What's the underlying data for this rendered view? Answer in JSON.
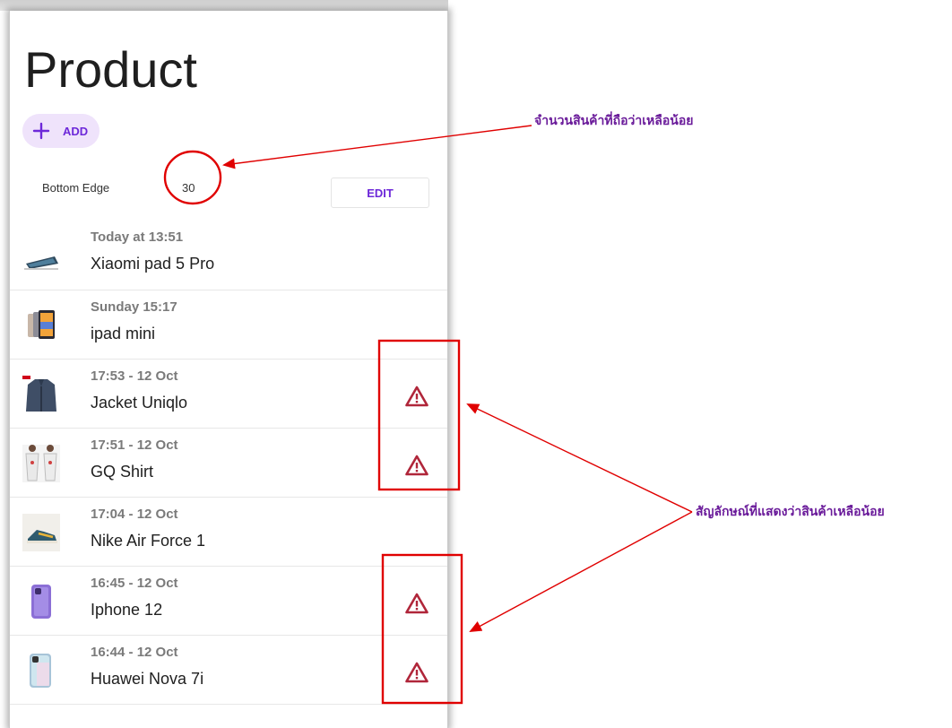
{
  "page": {
    "title": "Product"
  },
  "toolbar": {
    "add_label": "ADD",
    "edit_label": "EDIT"
  },
  "threshold": {
    "label": "Bottom Edge",
    "value": "30"
  },
  "products": [
    {
      "time": "Today at 13:51",
      "name": "Xiaomi pad 5 Pro",
      "low_stock": false,
      "thumb": "tablet-thumb"
    },
    {
      "time": "Sunday 15:17",
      "name": "ipad mini",
      "low_stock": false,
      "thumb": "ipad-thumb"
    },
    {
      "time": "17:53 - 12 Oct",
      "name": "Jacket Uniqlo",
      "low_stock": true,
      "thumb": "jacket-thumb"
    },
    {
      "time": "17:51 - 12 Oct",
      "name": "GQ Shirt",
      "low_stock": true,
      "thumb": "shirt-thumb"
    },
    {
      "time": "17:04 - 12 Oct",
      "name": "Nike Air Force 1",
      "low_stock": false,
      "thumb": "sneaker-thumb"
    },
    {
      "time": "16:45 - 12 Oct",
      "name": "Iphone 12",
      "low_stock": true,
      "thumb": "iphone-thumb"
    },
    {
      "time": "16:44 - 12 Oct",
      "name": "Huawei Nova 7i",
      "low_stock": true,
      "thumb": "huawei-thumb"
    }
  ],
  "annotations": {
    "threshold_note": "จำนวนสินค้าที่ถือว่าเหลือน้อย",
    "warning_note": "สัญลักษณ์ที่แสดงว่าสินค้าเหลือน้อย"
  },
  "colors": {
    "accent": "#6d28d9",
    "warning": "#b0263a",
    "annotation": "#e00000",
    "annotation_text": "#6a1b9a"
  }
}
